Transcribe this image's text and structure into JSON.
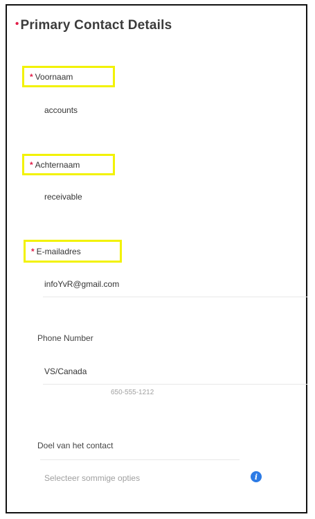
{
  "section": {
    "title": "Primary Contact Details"
  },
  "fields": {
    "first_name": {
      "label": "Voornaam",
      "value": "accounts"
    },
    "last_name": {
      "label": "Achternaam",
      "value": "receivable"
    },
    "email": {
      "label": "E-mailadres",
      "value": "infoYvR@gmail.com"
    },
    "phone": {
      "label": "Phone Number",
      "country": "VS/Canada",
      "example": "650-555-1212"
    },
    "purpose": {
      "label": "Doel van het contact",
      "placeholder": "Selecteer sommige opties"
    }
  },
  "colors": {
    "required_marker": "#e11d48",
    "highlight_box": "#f2f200",
    "info_icon": "#2d7be5"
  },
  "icons": {
    "info": "info-icon"
  }
}
